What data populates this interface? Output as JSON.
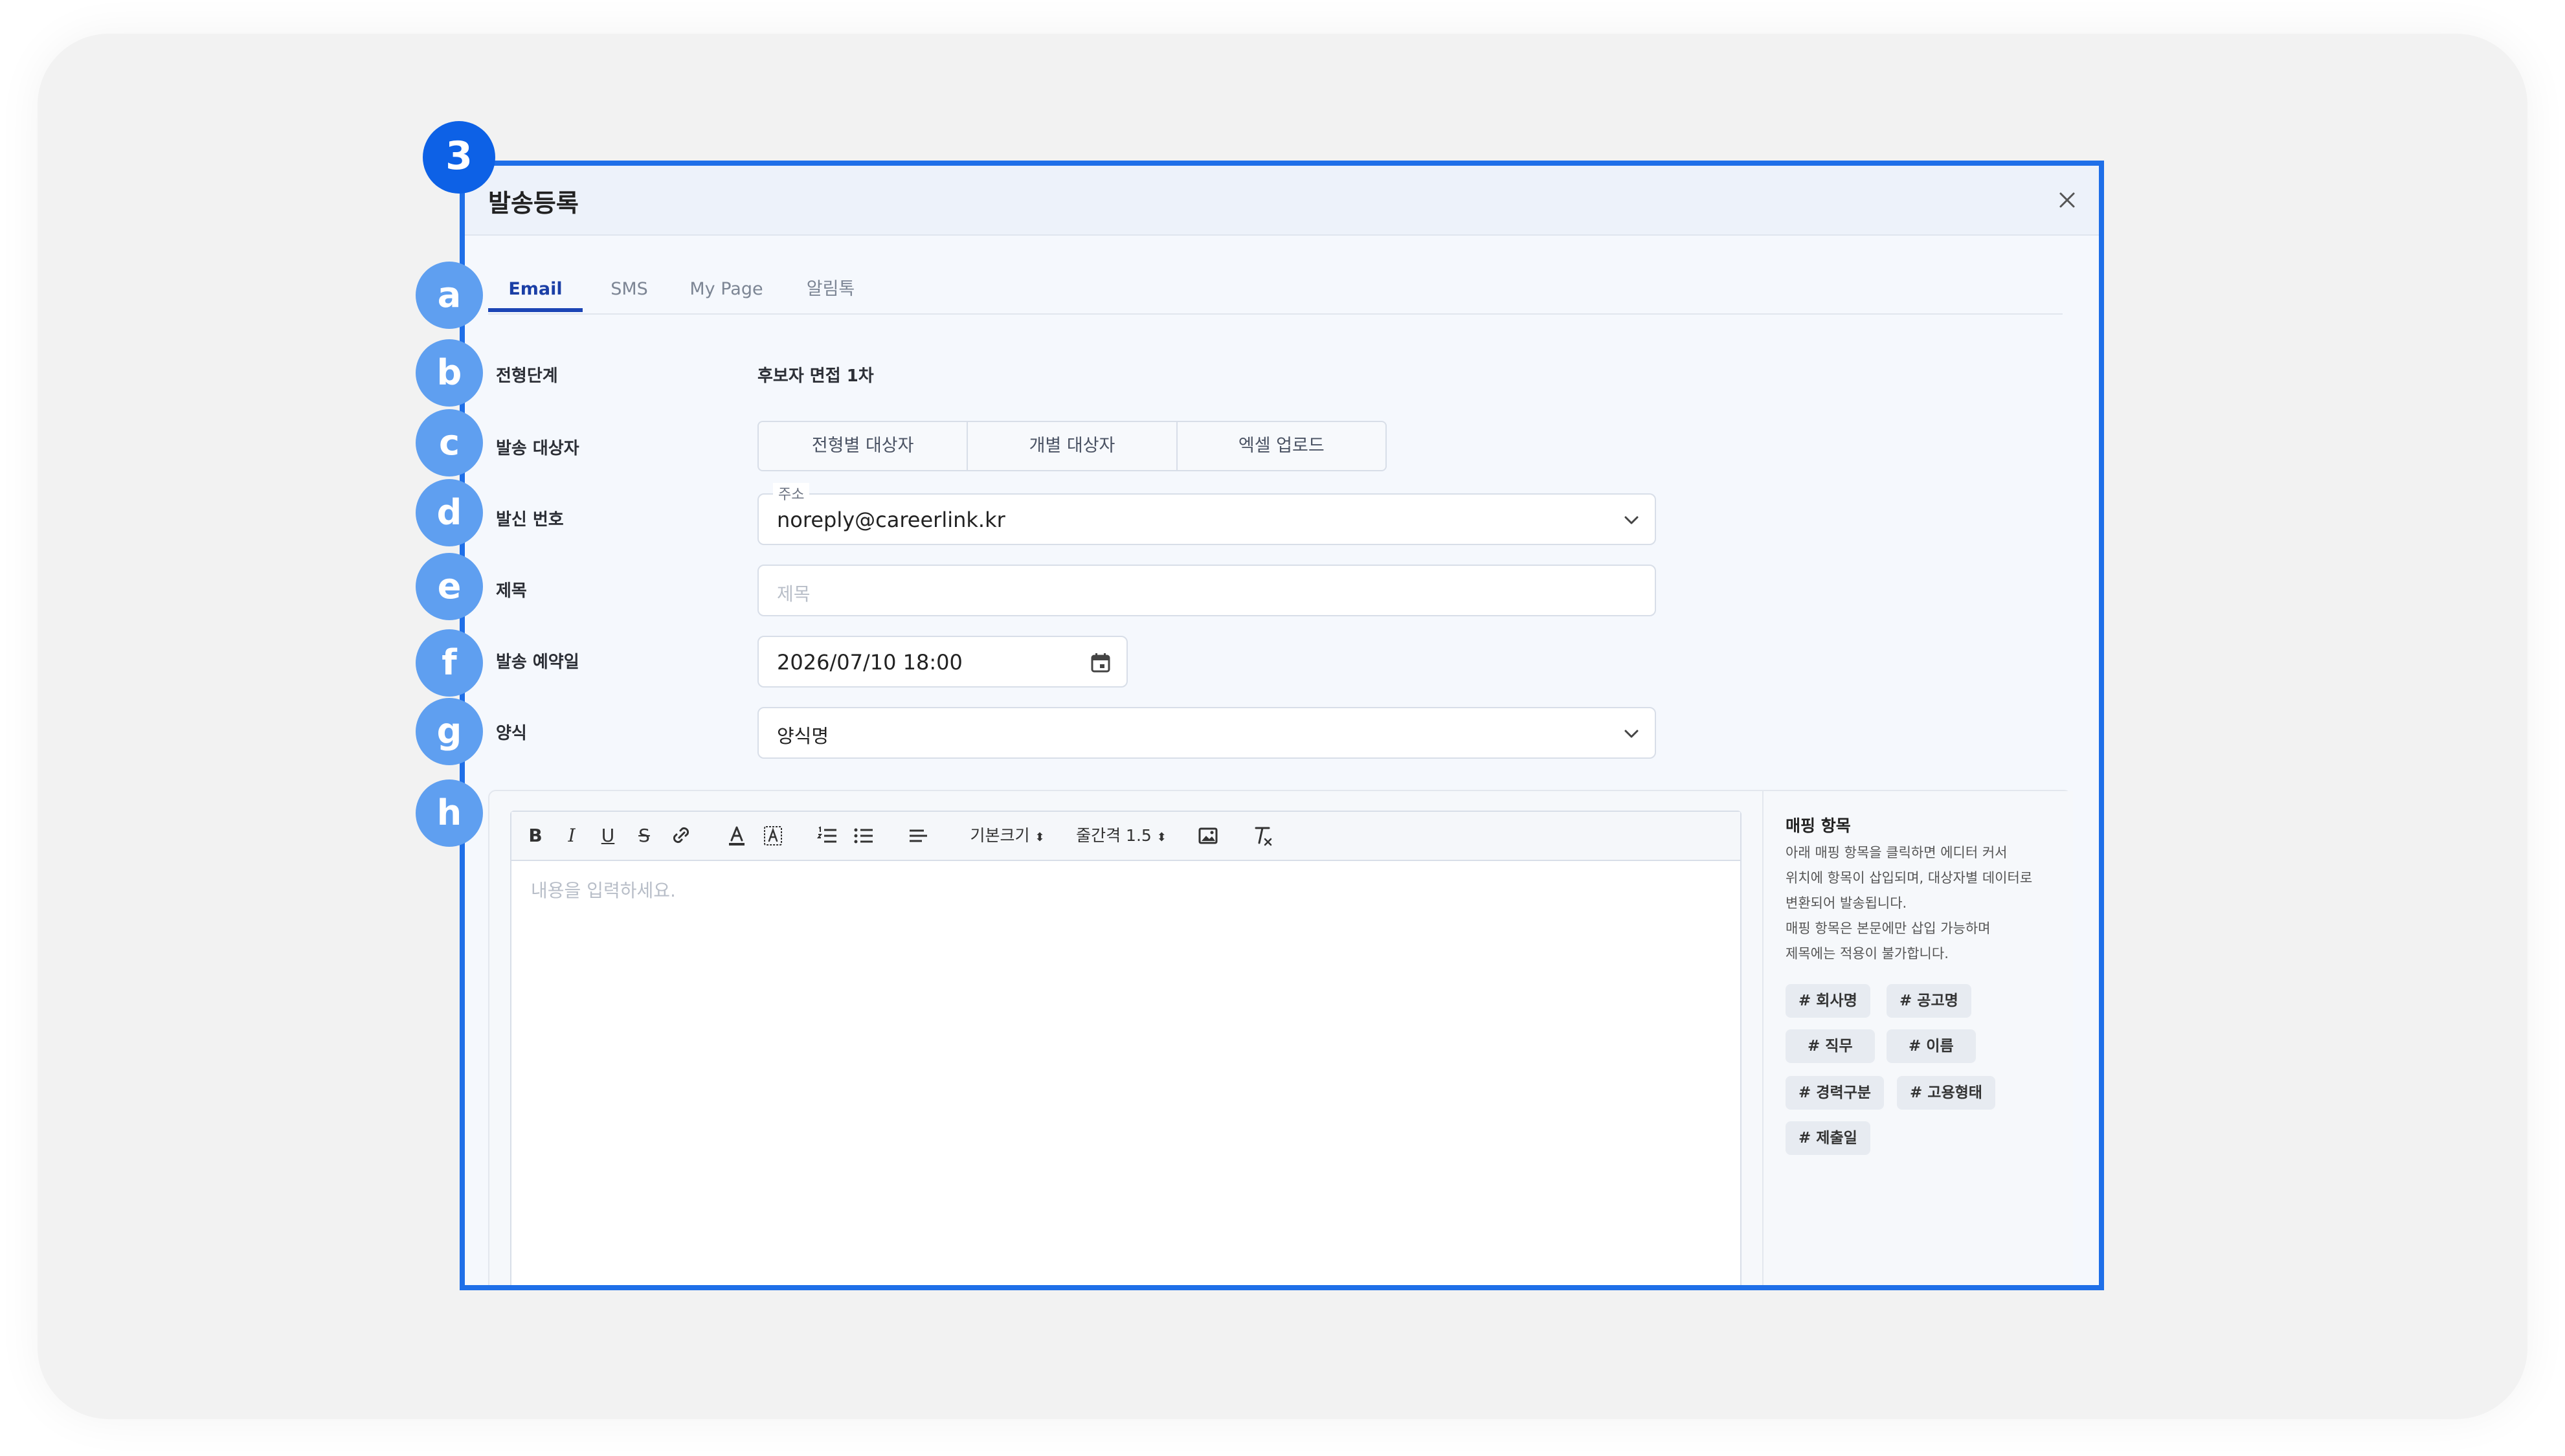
{
  "modal": {
    "title": "발송등록",
    "step_marker": "3",
    "close_icon": "close-icon"
  },
  "markers": [
    "a",
    "b",
    "c",
    "d",
    "e",
    "f",
    "g",
    "h"
  ],
  "tabs": [
    {
      "label": "Email",
      "active": true
    },
    {
      "label": "SMS",
      "active": false
    },
    {
      "label": "My Page",
      "active": false
    },
    {
      "label": "알림톡",
      "active": false
    }
  ],
  "form": {
    "stage": {
      "label": "전형단계",
      "value": "후보자 면접 1차"
    },
    "recipients": {
      "label": "발송 대상자",
      "options": [
        "전형별 대상자",
        "개별 대상자",
        "엑셀 업로드"
      ]
    },
    "sender": {
      "label": "발신 번호",
      "field_label": "주소",
      "value": "noreply@careerlink.kr"
    },
    "subject": {
      "label": "제목",
      "placeholder": "제목"
    },
    "schedule": {
      "label": "발송 예약일",
      "value": "2026/07/10 18:00"
    },
    "template": {
      "label": "양식",
      "value": "양식명"
    }
  },
  "editor": {
    "toolbar": {
      "bold": "B",
      "italic": "I",
      "underline": "U",
      "strike": "S",
      "font_size": "기본크기",
      "line_height": "줄간격 1.5",
      "icons": [
        "bold-icon",
        "italic-icon",
        "underline-icon",
        "strikethrough-icon",
        "link-icon",
        "font-color-icon",
        "highlight-icon",
        "ordered-list-icon",
        "bullet-list-icon",
        "align-left-icon",
        "image-icon",
        "clear-format-icon"
      ]
    },
    "placeholder": "내용을 입력하세요."
  },
  "mapping": {
    "title": "매핑 항목",
    "desc_lines": [
      "아래 매핑 항목을 클릭하면 에디터 커서",
      "위치에 항목이 삽입되며, 대상자별 데이터로",
      "변환되어 발송됩니다.",
      "매핑 항목은 본문에만 삽입 가능하며",
      "제목에는 적용이 불가합니다."
    ],
    "chips": [
      "# 회사명",
      "# 공고명",
      "# 직무",
      "# 이름",
      "# 경력구분",
      "# 고용형태",
      "# 제출일"
    ]
  },
  "colors": {
    "accent": "#1f6fe8",
    "marker": "#5f9ff0",
    "active_tab": "#1b45b5"
  }
}
